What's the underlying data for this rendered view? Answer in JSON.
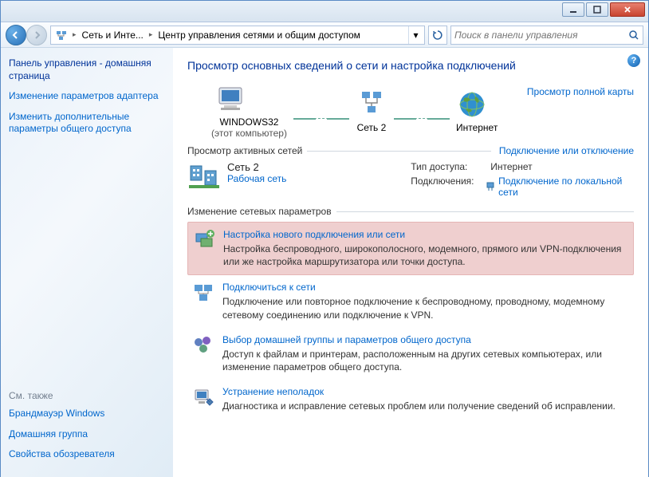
{
  "breadcrumb": {
    "seg1": "Сеть и Инте...",
    "seg2": "Центр управления сетями и общим доступом"
  },
  "search": {
    "placeholder": "Поиск в панели управления"
  },
  "sidebar": {
    "title": "Панель управления - домашняя страница",
    "links": [
      "Изменение параметров адаптера",
      "Изменить дополнительные параметры общего доступа"
    ],
    "see_also_label": "См. также",
    "see_also": [
      "Брандмауэр Windows",
      "Домашняя группа",
      "Свойства обозревателя"
    ]
  },
  "main": {
    "heading": "Просмотр основных сведений о сети и настройка подключений",
    "map": {
      "node1": "WINDOWS32",
      "node1_sub": "(этот компьютер)",
      "node2": "Сеть  2",
      "node3": "Интернет",
      "full_map_link": "Просмотр полной карты"
    },
    "active_section": {
      "label": "Просмотр активных сетей",
      "link": "Подключение или отключение",
      "net_name": "Сеть  2",
      "net_category": "Рабочая сеть",
      "access_type_label": "Тип доступа:",
      "access_type_value": "Интернет",
      "connections_label": "Подключения:",
      "connections_value": "Подключение по локальной сети"
    },
    "change_section_label": "Изменение сетевых параметров",
    "tasks": [
      {
        "title": "Настройка нового подключения или сети",
        "desc": "Настройка беспроводного, широкополосного, модемного, прямого или VPN-подключения или же настройка маршрутизатора или точки доступа."
      },
      {
        "title": "Подключиться к сети",
        "desc": "Подключение или повторное подключение к беспроводному, проводному, модемному сетевому соединению или подключение к VPN."
      },
      {
        "title": "Выбор домашней группы и параметров общего доступа",
        "desc": "Доступ к файлам и принтерам, расположенным на других сетевых компьютерах, или изменение параметров общего доступа."
      },
      {
        "title": "Устранение неполадок",
        "desc": "Диагностика и исправление сетевых проблем или получение сведений об исправлении."
      }
    ]
  }
}
